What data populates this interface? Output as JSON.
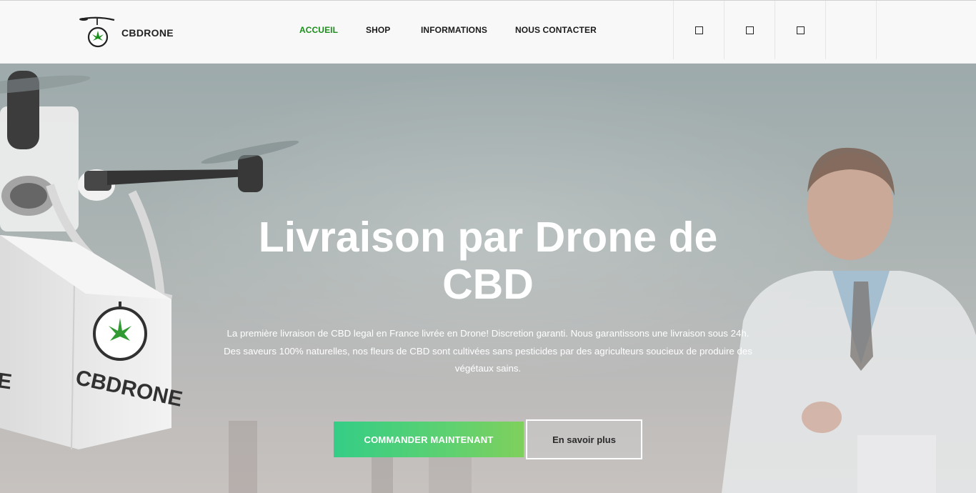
{
  "header": {
    "brand": "CBDRONE",
    "nav": [
      {
        "label": "ACCUEIL",
        "active": true
      },
      {
        "label": "SHOP",
        "active": false
      },
      {
        "label": "INFORMATIONS",
        "active": false
      },
      {
        "label": "NOUS CONTACTER",
        "active": false
      }
    ],
    "icons": [
      "square-icon",
      "square-icon",
      "square-icon"
    ]
  },
  "hero": {
    "title": "Livraison par Drone de CBD",
    "description": "La première livraison de CBD legal en France livrée en Drone! Discretion garanti. Nous garantissons une livraison sous 24h. Des saveurs 100% naturelles, nos fleurs de CBD sont cultivées sans pesticides par des agriculteurs soucieux de produire des végétaux sains.",
    "primary_button": "COMMANDER MAINTENANT",
    "secondary_button": "En savoir plus",
    "box_print": "CBDRONE"
  },
  "colors": {
    "accent": "#1b8f1b",
    "button_gradient_start": "#34cd86",
    "button_gradient_end": "#7fd05c",
    "hero_text": "#ffffff"
  }
}
